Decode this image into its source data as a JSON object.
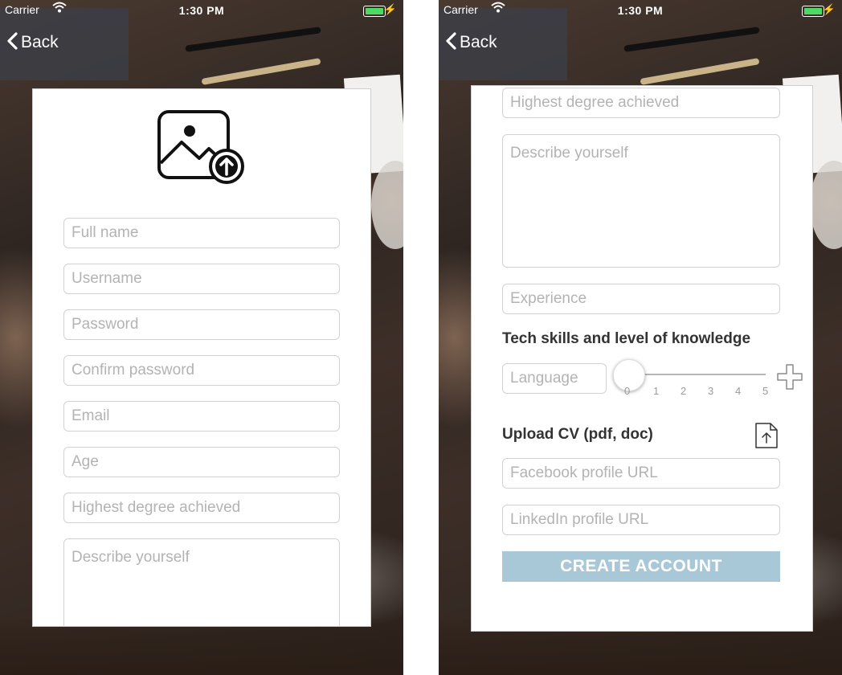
{
  "status_bar": {
    "carrier": "Carrier",
    "time": "1:30 PM",
    "wifi_icon": "wifi-icon",
    "battery_icon": "battery-icon",
    "charging_icon": "bolt-icon",
    "battery_color": "#4cd964"
  },
  "nav": {
    "back_label": "Back",
    "back_icon": "chevron-left-icon"
  },
  "left_screen": {
    "upload_photo_icon": "image-upload-icon",
    "fields": [
      {
        "placeholder": "Full name"
      },
      {
        "placeholder": "Username"
      },
      {
        "placeholder": "Password"
      },
      {
        "placeholder": "Confirm password"
      },
      {
        "placeholder": "Email"
      },
      {
        "placeholder": "Age"
      },
      {
        "placeholder": "Highest degree achieved"
      },
      {
        "placeholder": "Describe yourself"
      }
    ]
  },
  "right_screen": {
    "fields": {
      "degree": "Highest degree achieved",
      "describe": "Describe yourself",
      "experience": "Experience",
      "language": "Language",
      "facebook": "Facebook profile URL",
      "linkedin": "LinkedIn profile URL"
    },
    "tech_skills_label": "Tech skills and level of knowledge",
    "slider": {
      "value": 0,
      "min": 0,
      "max": 5,
      "ticks": [
        "0",
        "1",
        "2",
        "3",
        "4",
        "5"
      ]
    },
    "add_skill_icon": "plus-icon",
    "upload_cv_label": "Upload CV (pdf, doc)",
    "upload_cv_icon": "file-upload-icon",
    "create_account_label": "CREATE ACCOUNT",
    "create_account_color": "#a8c8d8"
  }
}
